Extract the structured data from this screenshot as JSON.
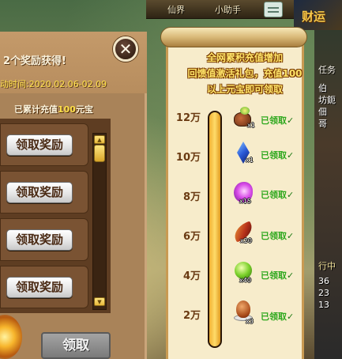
{
  "top_menu": {
    "fairy_label": "仙界",
    "helper_label": "小助手",
    "event_art_text": "财运"
  },
  "left_panel": {
    "title": "2个奖励获得!",
    "activity_time": "动时间:2020.02.06-02.09",
    "recharge_prefix": "已累计充值",
    "recharge_amount": "100",
    "recharge_suffix": "元宝",
    "reward_rows": [
      {
        "button_label": "领取奖励"
      },
      {
        "button_label": "领取奖励"
      },
      {
        "button_label": "领取奖励"
      },
      {
        "button_label": "领取奖励"
      }
    ],
    "claim_button_label": "领取"
  },
  "scroll_panel": {
    "promo_lines": [
      "全网累积充值增加",
      "回馈值激活礼包，充值100",
      "以上元宝即可领取"
    ],
    "progress_fraction": 1.0,
    "tiers": [
      {
        "threshold": "12万",
        "icon": "treasure-bag-icon",
        "qty": "x1",
        "status": "已领取",
        "check": "✓"
      },
      {
        "threshold": "10万",
        "icon": "blue-crystal-icon",
        "qty": "x1",
        "status": "已领取",
        "check": "✓"
      },
      {
        "threshold": "8万",
        "icon": "purple-swirl-icon",
        "qty": "x15",
        "status": "已领取",
        "check": "✓"
      },
      {
        "threshold": "6万",
        "icon": "fire-feather-icon",
        "qty": "x20",
        "status": "已领取",
        "check": "✓"
      },
      {
        "threshold": "4万",
        "icon": "green-gem-icon",
        "qty": "x40",
        "status": "已领取",
        "check": "✓"
      },
      {
        "threshold": "2万",
        "icon": "brown-egg-icon",
        "qty": "x3",
        "status": "已领取",
        "check": "✓"
      }
    ]
  },
  "right_edge": {
    "task_label": "任务",
    "fragments": [
      "伯",
      "坊鈪",
      "佃",
      "哥"
    ],
    "go_label": "行中",
    "lines": [
      "36",
      "23",
      "13"
    ]
  },
  "colors": {
    "panel_brown": "#a98359",
    "promo_yellow": "#ffe56a",
    "claimed_green": "#2fa81e",
    "tier_brown": "#6a3a12"
  }
}
